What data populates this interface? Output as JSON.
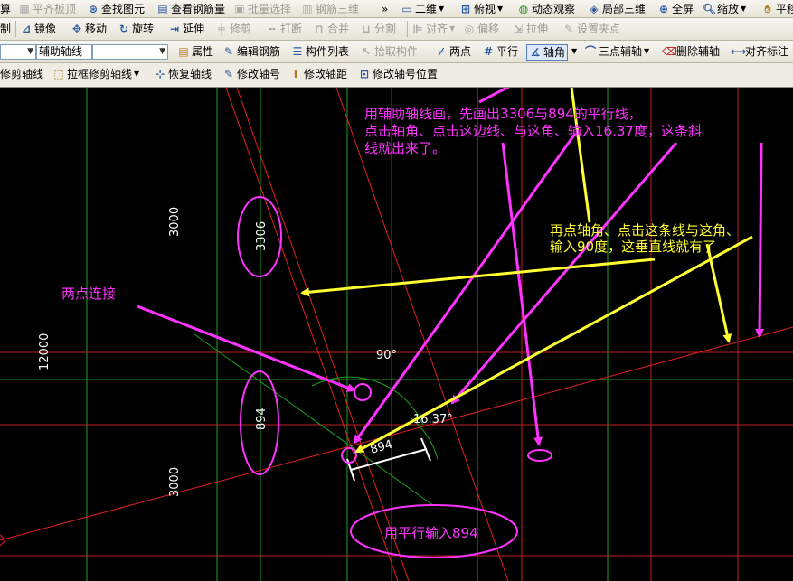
{
  "toolbar1": {
    "items": [
      {
        "label": "算",
        "enabled": true
      },
      {
        "label": "平齐板顶",
        "enabled": false
      },
      {
        "label": "查找图元",
        "enabled": true
      },
      {
        "label": "查看钢筋量",
        "enabled": true
      },
      {
        "label": "批量选择",
        "enabled": false
      },
      {
        "label": "钢筋三维",
        "enabled": false
      },
      {
        "label": "»",
        "enabled": true
      },
      {
        "label": "二维",
        "enabled": true
      },
      {
        "label": "俯视",
        "enabled": true
      },
      {
        "label": "动态观察",
        "enabled": true
      },
      {
        "label": "局部三维",
        "enabled": true
      },
      {
        "label": "全屏",
        "enabled": true
      },
      {
        "label": "缩放",
        "enabled": true
      },
      {
        "label": "平移",
        "enabled": true
      }
    ]
  },
  "toolbar2": {
    "items": [
      {
        "label": "制",
        "enabled": true
      },
      {
        "label": "镜像",
        "enabled": true
      },
      {
        "label": "移动",
        "enabled": true
      },
      {
        "label": "旋转",
        "enabled": true
      },
      {
        "label": "延伸",
        "enabled": true
      },
      {
        "label": "修剪",
        "enabled": false
      },
      {
        "label": "打断",
        "enabled": false
      },
      {
        "label": "合并",
        "enabled": false
      },
      {
        "label": "分割",
        "enabled": false
      },
      {
        "label": "对齐",
        "enabled": false
      },
      {
        "label": "偏移",
        "enabled": false
      },
      {
        "label": "拉伸",
        "enabled": false
      },
      {
        "label": "设置夹点",
        "enabled": false
      }
    ]
  },
  "toolbar3": {
    "combo1": "",
    "combo2": "辅助轴线",
    "combo3": "",
    "items": [
      {
        "label": "属性"
      },
      {
        "label": "编辑钢筋"
      },
      {
        "label": "构件列表"
      },
      {
        "label": "拾取构件",
        "enabled": false
      },
      {
        "label": "两点"
      },
      {
        "label": "平行"
      },
      {
        "label": "轴角"
      },
      {
        "label": "三点辅轴"
      },
      {
        "label": "删除辅轴"
      },
      {
        "label": "对齐标注"
      }
    ]
  },
  "toolbar4": {
    "items": [
      {
        "label": "修剪轴线"
      },
      {
        "label": "拉框修剪轴线"
      },
      {
        "label": "恢复轴线"
      },
      {
        "label": "修改轴号"
      },
      {
        "label": "修改轴距"
      },
      {
        "label": "修改轴号位置"
      }
    ]
  },
  "drawing": {
    "dims": {
      "v_3000_top": "3000",
      "v_12000": "12000",
      "v_3000_bottom": "3000",
      "v_3306": "3306",
      "v_894": "894",
      "angle_90": "90°",
      "angle_1637": "16.37°",
      "dim_894": "894"
    },
    "annotations": {
      "main_line1": "用辅助轴线画，先画出3306与894的平行线，",
      "main_line2": "点击轴角、点击这边线、与这角、输入16.37度，这条斜",
      "main_line3": "线就出来了。",
      "second_line1": "再点轴角、点击这条线与这角、",
      "second_line2": "输入90度，这垂直线就有了",
      "two_points": "两点连接",
      "parallel_894": "用平行输入894"
    },
    "colors": {
      "magenta": "#ff33ff",
      "yellow": "#ffff33",
      "red_axis": "#e02020",
      "green_axis": "#20a020",
      "white": "#ffffff"
    }
  }
}
